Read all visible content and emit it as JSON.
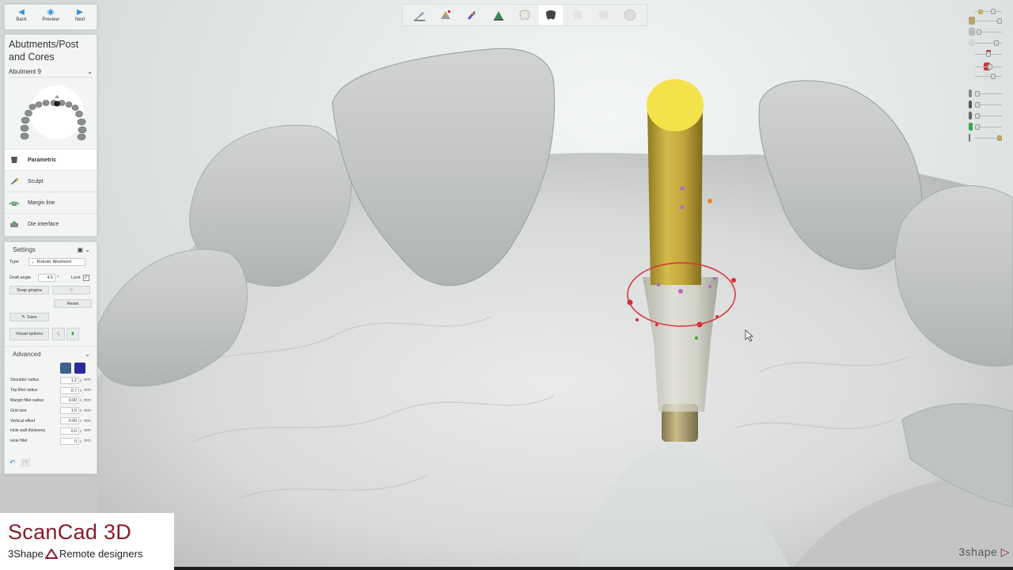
{
  "nav": {
    "back": "Back",
    "preview": "Preview",
    "next": "Next"
  },
  "step": {
    "title_line1": "Abutments/Post",
    "title_line2": "and Cores",
    "abutment_selector": "Abutment 9"
  },
  "tools": [
    {
      "label": "Parametric",
      "active": true
    },
    {
      "label": "Sculpt",
      "active": false
    },
    {
      "label": "Margin line",
      "active": false
    },
    {
      "label": "Die interface",
      "active": false
    }
  ],
  "settings": {
    "header": "Settings",
    "type_label": "Type",
    "type_value": "Robotic Abutment",
    "draft_angle_label": "Draft angle",
    "draft_angle_value": "4.5",
    "draft_angle_unit": "°",
    "lock_label": "Lock",
    "lock_checked": true,
    "snap_gingiva": "Snap gingiva",
    "reset": "Reset",
    "save": "Save",
    "visual_options": "Visual options"
  },
  "advanced": {
    "header": "Advanced",
    "fields": [
      {
        "label": "Shoulder radius",
        "value": "1.2",
        "unit": "mm"
      },
      {
        "label": "Top fillet radius",
        "value": "0.7",
        "unit": "mm"
      },
      {
        "label": "Margin fillet radius",
        "value": "0.00",
        "unit": "mm"
      },
      {
        "label": "Grid size",
        "value": "1.0",
        "unit": "mm"
      },
      {
        "label": "Vertical offset",
        "value": "0.00",
        "unit": "mm"
      },
      {
        "label": "Hole wall thickness",
        "value": "0.0",
        "unit": "mm"
      },
      {
        "label": "Hole fillet",
        "value": "0",
        "unit": "mm"
      }
    ]
  },
  "toolbar_icons": [
    "scalpel-icon",
    "implant-tools-icon",
    "implant-screw-icon",
    "gingiva-icon",
    "tooth-white-icon",
    "tooth-dark-icon",
    "tooth-ghost-icon",
    "tooth-ghost2-icon",
    "sphere-icon"
  ],
  "right_sliders": [
    {
      "icon": "model-visibility-icon",
      "level": 0.8
    },
    {
      "icon": "tray-icon",
      "level": 0.95
    },
    {
      "icon": "antagonist-icon",
      "level": 0.1
    },
    {
      "icon": "gingiva-visibility-icon",
      "level": 0.8
    },
    {
      "icon": "crown-red-icon",
      "level": 0.5
    },
    {
      "icon": "crown-white-icon",
      "level": 0.7
    },
    {
      "icon": "implant-gray-icon",
      "level": 0.05
    },
    {
      "icon": "implant-dark-icon",
      "level": 0.05
    },
    {
      "icon": "implant-green-icon",
      "level": 0.05
    },
    {
      "icon": "pin-icon",
      "level": 0.95
    }
  ],
  "brand": {
    "name": "ScanCad 3D",
    "sub_prefix": "3Shape",
    "sub_suffix": "Remote designers",
    "logo": "3shape"
  },
  "colors": {
    "abutment_gold": "#c9ad3c",
    "abutment_top": "#f4e24a",
    "margin_red": "#d6303a",
    "brand_red": "#8b1b2a",
    "accent_blue": "#3a8fd6"
  }
}
